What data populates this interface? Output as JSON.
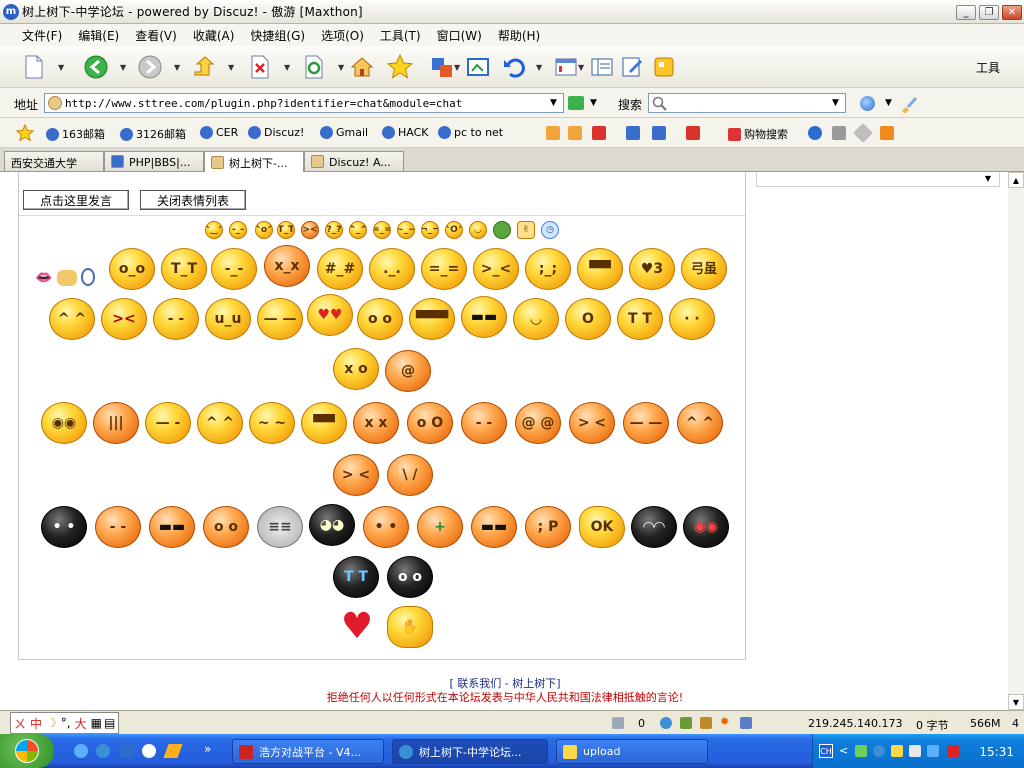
{
  "window": {
    "title": "树上树下-中学论坛 - powered by Discuz! - 傲游 [Maxthon]",
    "app_icon": "m",
    "min_label": "_",
    "max_label": "❐",
    "close_label": "✕"
  },
  "menu": [
    "文件(F)",
    "编辑(E)",
    "查看(V)",
    "收藏(A)",
    "快捷组(G)",
    "选项(O)",
    "工具(T)",
    "窗口(W)",
    "帮助(H)"
  ],
  "toolbar": {
    "tools_label": "工具"
  },
  "address": {
    "label": "地址",
    "url": "http://www.sttree.com/plugin.php?identifier=chat&module=chat",
    "search_label": "搜索"
  },
  "links": [
    "163邮箱",
    "3126邮箱",
    "CER",
    "Discuz!",
    "Gmail",
    "HACK",
    "pc to net",
    "购物搜索"
  ],
  "tabs": [
    "西安交通大学",
    "PHP|BBS|...",
    "树上树下-...",
    "Discuz! A..."
  ],
  "content": {
    "post_button": "点击这里发言",
    "close_list_button": "关闭表情列表",
    "footer_link": "[ 联系我们 - 树上树下]",
    "footer_warning": "拒绝任何人以任何形式在本论坛发表与中华人民共和国法律相抵触的言论!"
  },
  "colors": {
    "accent_blue": "#245ddb",
    "warning_red": "#c00000",
    "link_blue": "#1a2e8a",
    "emoticon_yellow": "#ffd83a"
  },
  "status": {
    "ime_chars": "中",
    "ime_chars2": "大",
    "count_a": "0",
    "ip": "219.245.140.173",
    "bytes": "0 字节",
    "memory": "566M",
    "tail": "4"
  },
  "taskbar": {
    "tasks": [
      "浩方对战平台 - V4...",
      "树上树下-中学论坛...",
      "upload"
    ],
    "tray_lang": "CH",
    "clock": "15:31"
  },
  "emoticon_text": {
    "egg": "弓虽"
  }
}
